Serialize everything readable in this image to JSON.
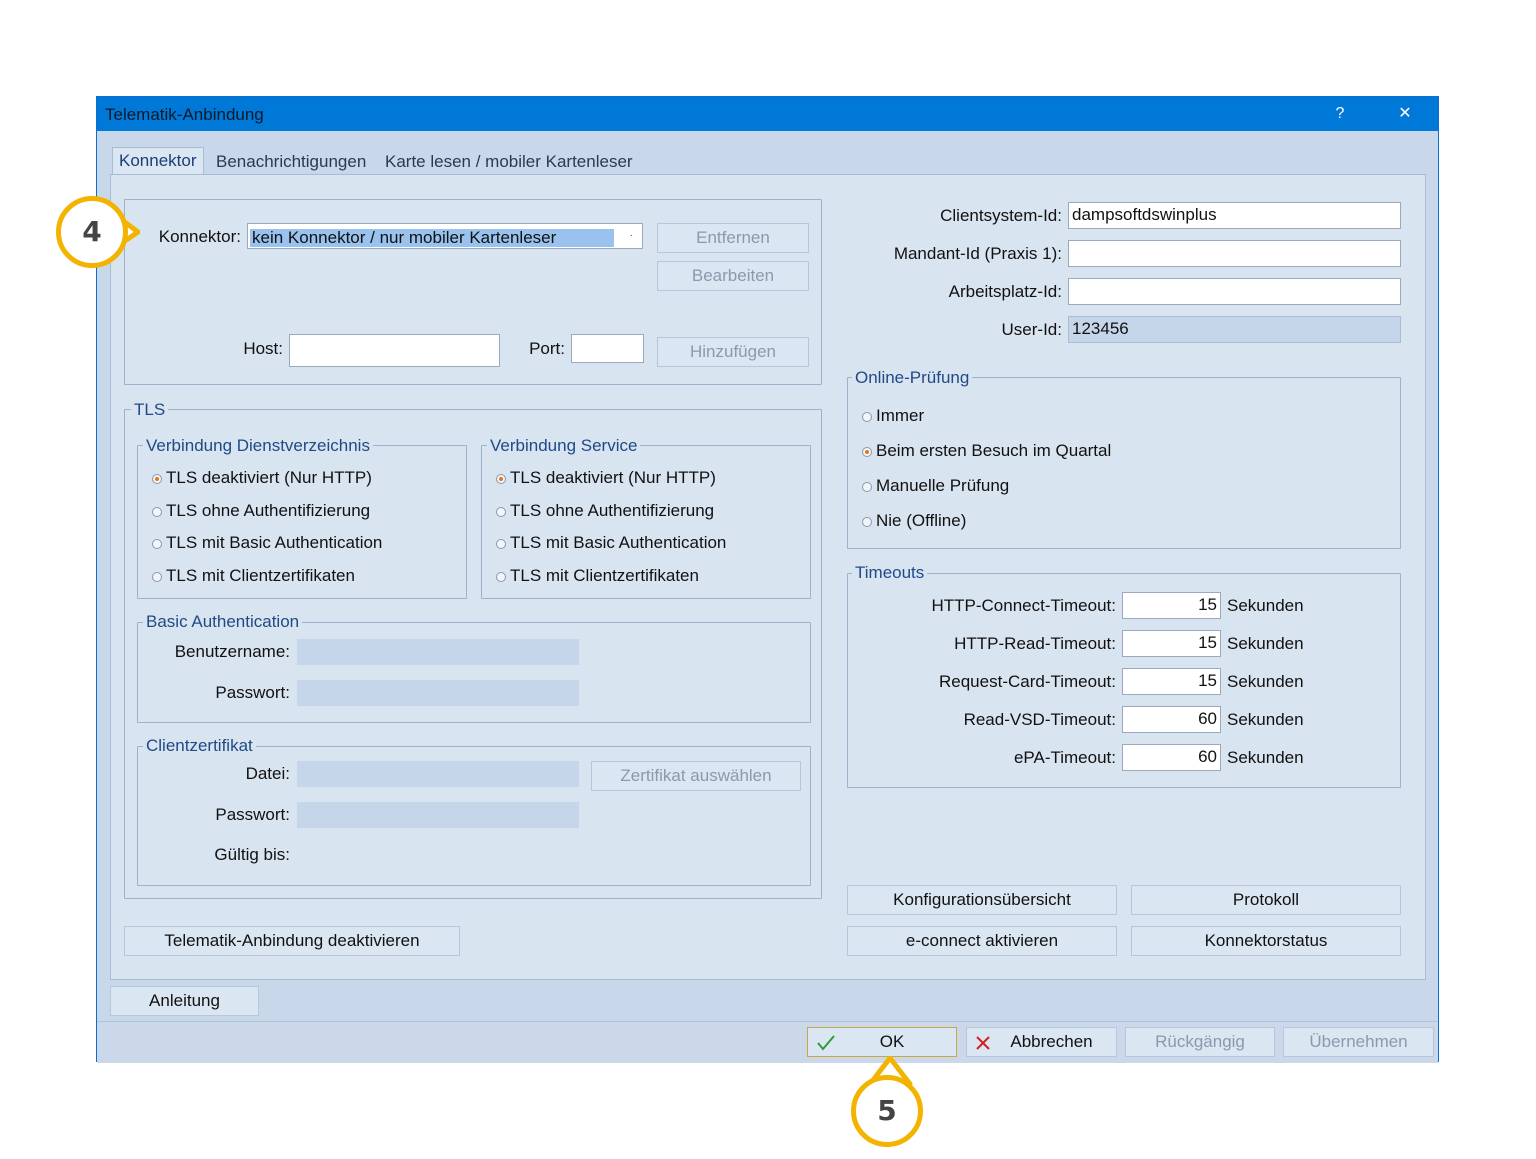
{
  "window": {
    "title": "Telematik-Anbindung",
    "help_glyph": "?",
    "close_glyph": "✕"
  },
  "tabs": [
    {
      "label": "Konnektor"
    },
    {
      "label": "Benachrichtigungen"
    },
    {
      "label": "Karte lesen / mobiler Kartenleser"
    }
  ],
  "konnektor": {
    "label": "Konnektor:",
    "value": "kein Konnektor / nur mobiler Kartenleser",
    "remove": "Entfernen",
    "edit": "Bearbeiten",
    "host_label": "Host:",
    "host_value": "",
    "port_label": "Port:",
    "port_value": "",
    "add": "Hinzufügen"
  },
  "tls": {
    "legend": "TLS",
    "dienst": {
      "legend": "Verbindung Dienstverzeichnis",
      "options": [
        "TLS deaktiviert (Nur HTTP)",
        "TLS ohne Authentifizierung",
        "TLS mit Basic Authentication",
        "TLS mit Clientzertifikaten"
      ],
      "selected": 0
    },
    "service": {
      "legend": "Verbindung Service",
      "options": [
        "TLS deaktiviert (Nur HTTP)",
        "TLS ohne Authentifizierung",
        "TLS mit Basic Authentication",
        "TLS mit Clientzertifikaten"
      ],
      "selected": 0
    },
    "basic": {
      "legend": "Basic Authentication",
      "user_label": "Benutzername:",
      "pass_label": "Passwort:"
    },
    "cert": {
      "legend": "Clientzertifikat",
      "file_label": "Datei:",
      "select": "Zertifikat auswählen",
      "pass_label": "Passwort:",
      "valid_label": "Gültig bis:"
    }
  },
  "ids": {
    "client_label": "Clientsystem-Id:",
    "client_value": "dampsoftdswinplus",
    "mandant_label": "Mandant-Id (Praxis 1):",
    "mandant_value": "",
    "platz_label": "Arbeitsplatz-Id:",
    "platz_value": "",
    "user_label": "User-Id:",
    "user_value": "123456"
  },
  "online": {
    "legend": "Online-Prüfung",
    "options": [
      "Immer",
      "Beim ersten Besuch im Quartal",
      "Manuelle Prüfung",
      "Nie (Offline)"
    ],
    "selected": 1
  },
  "timeouts": {
    "legend": "Timeouts",
    "unit": "Sekunden",
    "rows": [
      {
        "label": "HTTP-Connect-Timeout:",
        "value": "15"
      },
      {
        "label": "HTTP-Read-Timeout:",
        "value": "15"
      },
      {
        "label": "Request-Card-Timeout:",
        "value": "15"
      },
      {
        "label": "Read-VSD-Timeout:",
        "value": "60"
      },
      {
        "label": "ePA-Timeout:",
        "value": "60"
      }
    ]
  },
  "buttons": {
    "config": "Konfigurationsübersicht",
    "protokoll": "Protokoll",
    "deactivate": "Telematik-Anbindung deaktivieren",
    "econnect": "e-connect aktivieren",
    "status": "Konnektorstatus",
    "anleitung": "Anleitung",
    "ok": "OK",
    "cancel": "Abbrechen",
    "undo": "Rückgängig",
    "apply": "Übernehmen"
  },
  "callouts": {
    "step4": "4",
    "step5": "5"
  },
  "colors": {
    "titlebar": "#0078d7",
    "accent": "#f2b400",
    "check": "#2e9a3a",
    "cross": "#d42020"
  }
}
